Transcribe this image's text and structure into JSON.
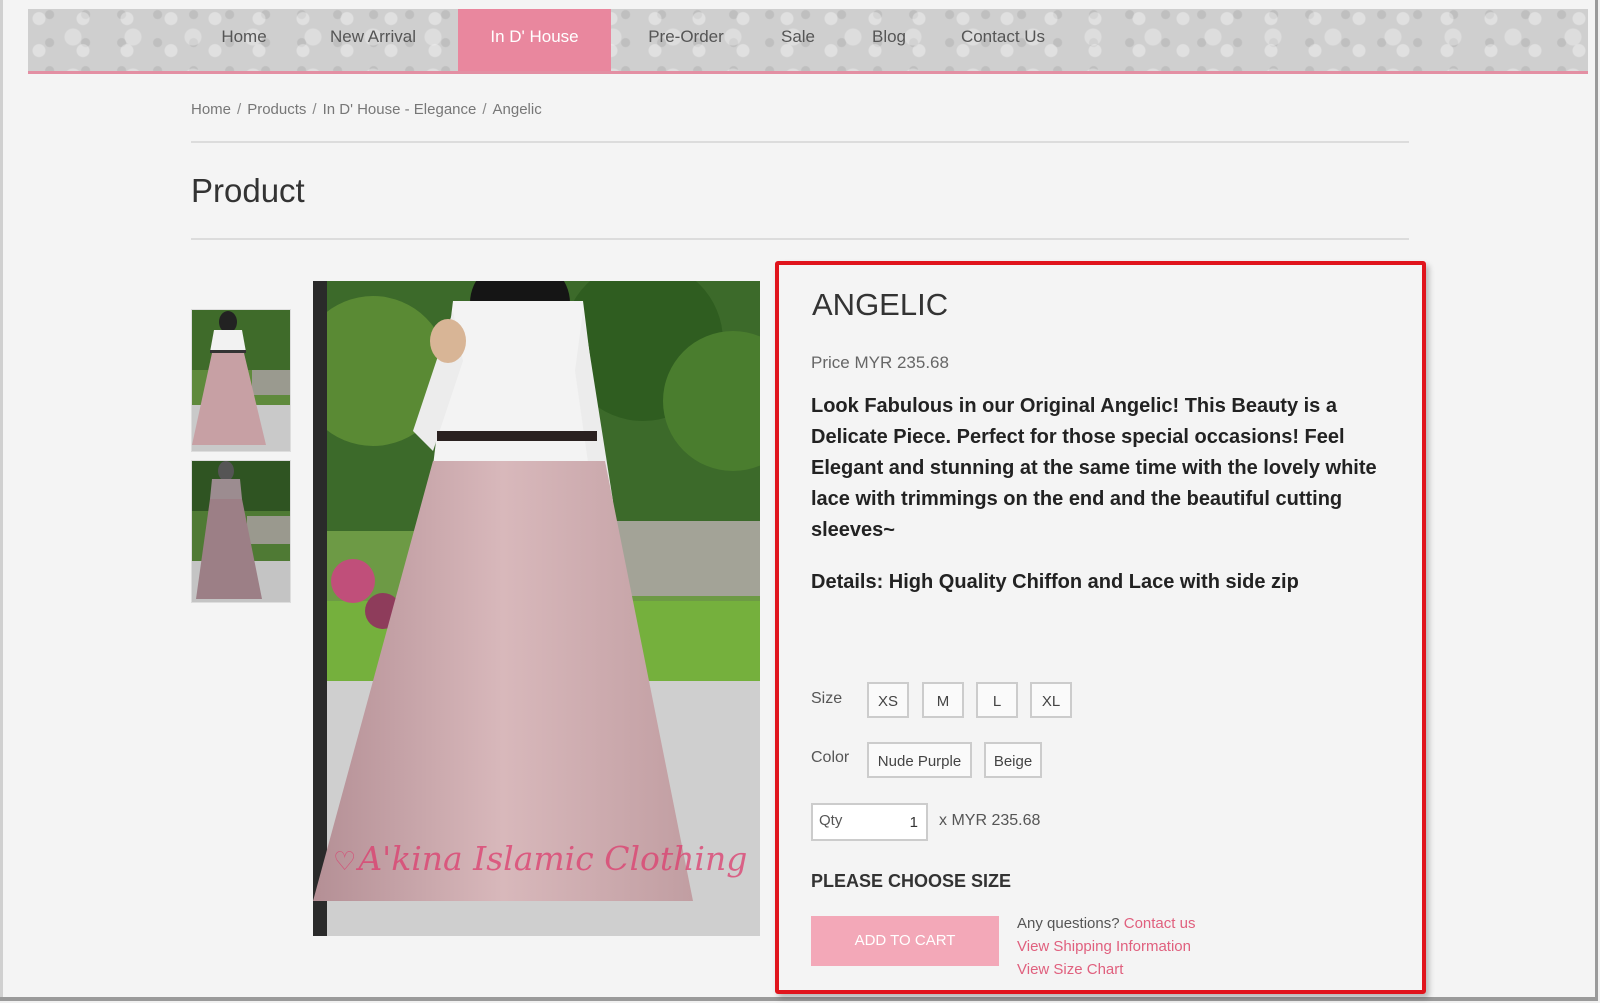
{
  "nav": {
    "items": [
      {
        "label": "Home"
      },
      {
        "label": "New Arrival"
      },
      {
        "label": "In D' House",
        "active": true
      },
      {
        "label": "Pre-Order"
      },
      {
        "label": "Sale"
      },
      {
        "label": "Blog"
      },
      {
        "label": "Contact Us"
      }
    ],
    "active_color": "#e9879e"
  },
  "breadcrumb": [
    "Home",
    "Products",
    "In D' House - Elegance",
    "Angelic"
  ],
  "page_title": "Product",
  "gallery": {
    "watermark": "A'kina Islamic Clothing"
  },
  "product": {
    "name": "ANGELIC",
    "price": "Price MYR 235.68",
    "description": "Look Fabulous in our  Original Angelic! This Beauty is a Delicate Piece. Perfect for  those special occasions! Feel Elegant and stunning at the same time with the lovely white lace with trimmings on the end and the beautiful cutting sleeves~",
    "details": "Details: High Quality Chiffon and Lace with side zip",
    "size_label": "Size",
    "sizes": [
      "XS",
      "M",
      "L",
      "XL"
    ],
    "color_label": "Color",
    "colors": [
      "Nude Purple",
      "Beige"
    ],
    "qty_placeholder": "Qty",
    "qty_value": "1",
    "qty_price": "x  MYR 235.68",
    "choose_size": "PLEASE CHOOSE SIZE",
    "add_to_cart": "ADD TO CART",
    "questions_text": "Any questions?",
    "contact_link": "Contact us",
    "shipping_link": "View Shipping Information",
    "size_chart_link": "View Size Chart"
  },
  "colors": {
    "highlight_border": "#e0141c",
    "button": "#f3a8b8",
    "link": "#e0607e"
  }
}
